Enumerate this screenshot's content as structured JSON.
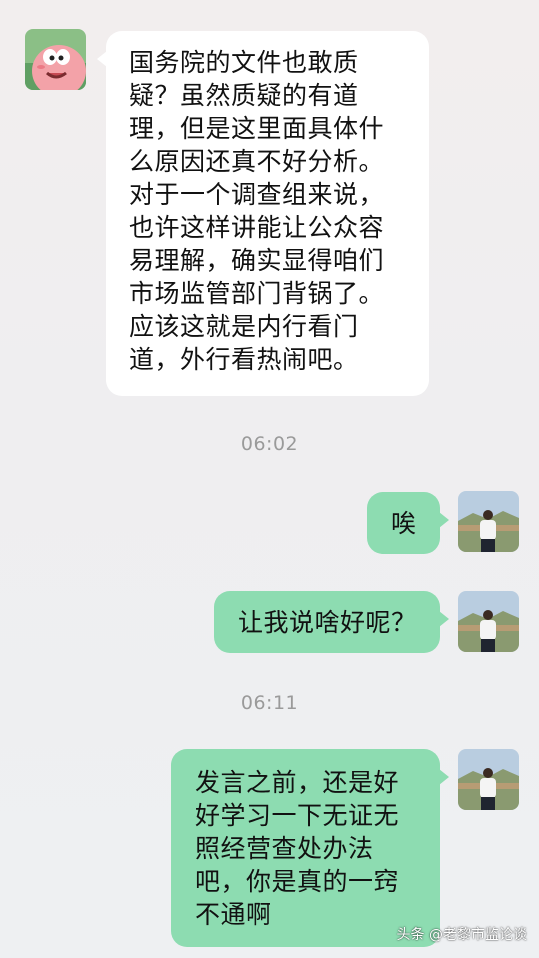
{
  "messages": [
    {
      "side": "left",
      "lines": [
        "国务院的文件也敢质",
        "疑？虽然质疑的有道",
        "理，但是这里面具体什",
        "么原因还真不好分析。",
        "对于一个调查组来说，",
        "也许这样讲能让公众容",
        "易理解，确实显得咱们",
        "市场监管部门背锅了。",
        "应该这就是内行看门",
        "道，外行看热闹吧。"
      ]
    },
    {
      "time": "06:02"
    },
    {
      "side": "right",
      "lines": [
        "唉"
      ]
    },
    {
      "side": "right",
      "lines": [
        "让我说啥好呢？"
      ]
    },
    {
      "time": "06:11"
    },
    {
      "side": "right",
      "lines": [
        "发言之前，还是好",
        "好学习一下无证无",
        "照经营查处办法",
        "吧，你是真的一窍",
        "不通啊"
      ]
    }
  ],
  "watermark": {
    "text": "头条 @老黎市监论谈"
  },
  "colors": {
    "right_bubble": "#8ddcb1",
    "left_bubble": "#ffffff",
    "time_text": "#9a9a9a"
  }
}
